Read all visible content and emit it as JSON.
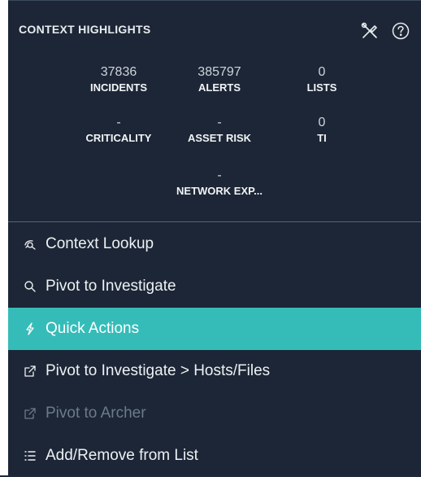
{
  "panel": {
    "title": "CONTEXT HIGHLIGHTS",
    "tools_icon": "wrench-screwdriver-icon",
    "help_icon": "question-circle-icon"
  },
  "stats": [
    {
      "value": "37836",
      "label": "INCIDENTS"
    },
    {
      "value": "385797",
      "label": "ALERTS"
    },
    {
      "value": "0",
      "label": "LISTS"
    },
    {
      "value": "-",
      "label": "CRITICALITY"
    },
    {
      "value": "-",
      "label": "ASSET RISK"
    },
    {
      "value": "0",
      "label": "TI"
    },
    {
      "value": "-",
      "label": "NETWORK EXP..."
    }
  ],
  "menu": [
    {
      "label": "Context Lookup",
      "icon": "context-lookup-icon",
      "state": "normal"
    },
    {
      "label": "Pivot to Investigate",
      "icon": "search-icon",
      "state": "normal"
    },
    {
      "label": "Quick Actions",
      "icon": "lightning-icon",
      "state": "active"
    },
    {
      "label": "Pivot to Investigate > Hosts/Files",
      "icon": "external-link-icon",
      "state": "normal"
    },
    {
      "label": "Pivot to Archer",
      "icon": "external-link-icon",
      "state": "disabled"
    },
    {
      "label": "Add/Remove from List",
      "icon": "list-icon",
      "state": "normal"
    }
  ],
  "colors": {
    "background": "#1c2636",
    "active": "#35bcb8",
    "text": "#eef1f4",
    "disabled": "#6d7a8a"
  }
}
